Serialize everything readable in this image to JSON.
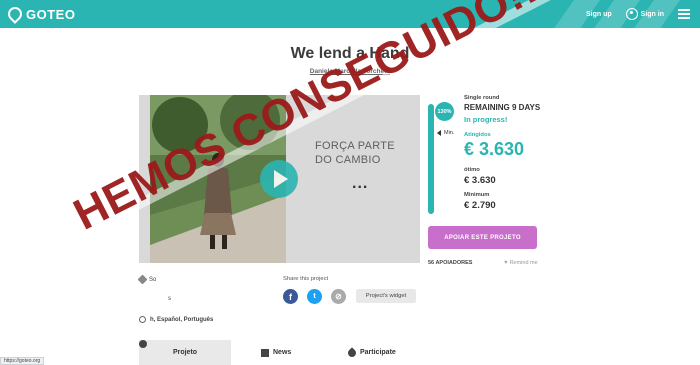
{
  "header": {
    "logo_text": "GOTEO",
    "signup_label": "Sign up",
    "signin_label": "Sign in",
    "menu_icon": "hamburger-icon",
    "background_color": "#2bb5b2"
  },
  "project": {
    "title": "We lend a Hand",
    "author": "Daniela Marcolla Torchetti"
  },
  "video": {
    "slogan_line1": "FORÇA PARTE",
    "slogan_line2": "DO CAMBIO",
    "ellipsis": "...",
    "play_icon": "play-icon"
  },
  "funding": {
    "percent_label": "130%",
    "percent_value": 1.3,
    "min_label": "Min.",
    "round_label": "Single round",
    "remaining_text": "REMAINING 9 DAYS",
    "status_text": "In progress!",
    "raised_label": "Atingidos",
    "raised_value": "€ 3.630",
    "optimum_label": "ótimo",
    "optimum_value": "€ 3.630",
    "minimum_label": "Minimum",
    "minimum_value": "€ 2.790",
    "accent_color": "#2bb5b2"
  },
  "actions": {
    "support_button": "APOIAR ESTE PROJETO",
    "support_color": "#c86fcb",
    "backers_text": "56 APOIADORES",
    "remind_text": "Remind me"
  },
  "meta": {
    "category_text": "So",
    "location_text": "s",
    "languages_text": "h, Español, Português"
  },
  "share": {
    "title": "Share this project",
    "widget_button": "Project's widget",
    "facebook_glyph": "f",
    "twitter_glyph": "t",
    "link_glyph": "⊘"
  },
  "tabs": [
    {
      "label": "Projeto",
      "icon": "bulb-icon"
    },
    {
      "label": "News",
      "icon": "newspaper-icon"
    },
    {
      "label": "Participate",
      "icon": "drop-icon"
    }
  ],
  "status_bar": {
    "url": "https://goteo.org"
  },
  "overlay": {
    "stamp_text": "HEMOS CONSEGUIDO!!!",
    "stamp_color": "#9b1a1a"
  }
}
